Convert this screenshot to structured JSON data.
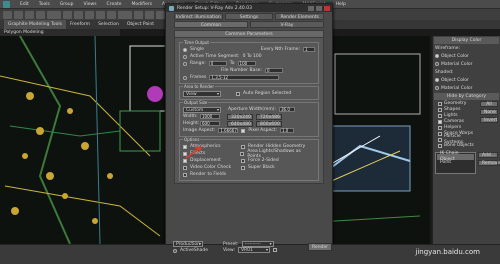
{
  "window": {
    "title": "Render Setup: V-Ray Adv 2.40.03"
  },
  "menubar": [
    "Edit",
    "Tools",
    "Group",
    "Views",
    "Create",
    "Modifiers",
    "Animation",
    "Graph Editors",
    "Rendering",
    "Customize",
    "MAXScript",
    "Help"
  ],
  "ribbon": {
    "tabs": [
      "Graphite Modeling Tools",
      "Freeform",
      "Selection",
      "Object Paint"
    ],
    "sub": "Polygon Modeling"
  },
  "dialog": {
    "tabs_top": [
      "Indirect illumination",
      "Settings",
      "Render Elements"
    ],
    "tabs_bottom": [
      "Common",
      "V-Ray"
    ],
    "section_title": "Common Parameters",
    "time_output": {
      "label": "Time Output",
      "single": "Single",
      "every_nth": "Every Nth Frame:",
      "every_nth_val": "1",
      "active_segment": "Active Time Segment:",
      "active_range": "0 To 100",
      "range": "Range:",
      "range_from": "0",
      "range_to": "100",
      "file_number_base": "File Number Base:",
      "file_number_base_val": "0",
      "frames": "Frames",
      "frames_val": "1,3,5-12"
    },
    "area_to_render": {
      "label": "Area to Render",
      "value": "View",
      "auto_region": "Auto Region Selected"
    },
    "output_size": {
      "label": "Output Size",
      "preset": "Custom",
      "aperture_label": "Aperture Width(mm):",
      "aperture_val": "36.0",
      "width_label": "Width:",
      "width_val": "1000",
      "height_label": "Height:",
      "height_val": "600",
      "presets": [
        "320x240",
        "720x486",
        "640x480",
        "800x600"
      ],
      "image_aspect_label": "Image Aspect:",
      "image_aspect_val": "1.66667",
      "pixel_aspect_label": "Pixel Aspect:",
      "pixel_aspect_val": "1.0"
    },
    "options": {
      "label": "Options",
      "atmospherics": "Atmospherics",
      "render_hidden": "Render Hidden Geometry",
      "effects": "Effects",
      "area_lights": "Area Lights/Shadows as Points",
      "displacement": "Displacement",
      "force_2sided": "Force 2-Sided",
      "video_color": "Video Color Check",
      "super_black": "Super Black",
      "render_fields": "Render to Fields"
    },
    "bottom": {
      "mode": "Production",
      "preset_label": "Preset:",
      "preset_val": "----------",
      "view_label": "View:",
      "view_val": "VR01",
      "render_btn": "Render",
      "activeshade": "ActiveShade"
    }
  },
  "rightpanel": {
    "display_color": "Display Color",
    "wireframe": "Wireframe:",
    "shaded": "Shaded:",
    "object_color": "Object Color",
    "material_color": "Material Color",
    "hide_by_category": "Hide by Category",
    "categories": [
      "Geometry",
      "Shapes",
      "Lights",
      "Cameras",
      "Helpers",
      "Space Warps",
      "Particle Systems",
      "Bone Objects"
    ],
    "buttons": [
      "All",
      "None",
      "Invert"
    ],
    "add": "Add...",
    "remove": "Remove",
    "list_item": "IK Chain Object",
    "list_item2": "Point"
  },
  "watermark": "jingyan.baidu.com",
  "colors": {
    "swatch1": "#1f7fd1",
    "swatch2": "#3a3a3a",
    "arrow": "#e03a2a"
  }
}
